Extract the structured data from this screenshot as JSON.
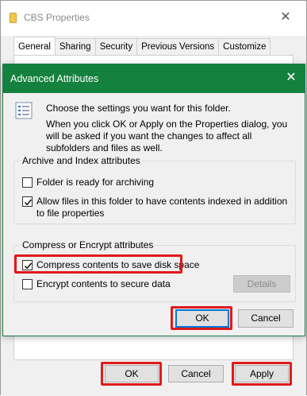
{
  "properties_window": {
    "title": "CBS Properties",
    "tabs": [
      "General",
      "Sharing",
      "Security",
      "Previous Versions",
      "Customize"
    ],
    "active_tab": "General",
    "buttons": {
      "ok": "OK",
      "cancel": "Cancel",
      "apply": "Apply"
    }
  },
  "advanced_dialog": {
    "title": "Advanced Attributes",
    "intro_line": "Choose the settings you want for this folder.",
    "intro_paragraph": "When you click OK or Apply on the Properties dialog, you will be asked if you want the changes to affect all subfolders and files as well.",
    "archive_group": {
      "label": "Archive and Index attributes",
      "options": [
        {
          "label": "Folder is ready for archiving",
          "checked": false
        },
        {
          "label": "Allow files in this folder to have contents indexed in addition to file properties",
          "checked": true
        }
      ]
    },
    "compress_group": {
      "label": "Compress or Encrypt attributes",
      "options": [
        {
          "label": "Compress contents to save disk space",
          "checked": true
        },
        {
          "label": "Encrypt contents to secure data",
          "checked": false
        }
      ],
      "details_label": "Details"
    },
    "buttons": {
      "ok": "OK",
      "cancel": "Cancel"
    }
  },
  "colors": {
    "dialog_titlebar": "#15813f",
    "highlight": "#e0191b",
    "focus_border": "#0078d7"
  },
  "icons": [
    "folder-icon",
    "close-icon",
    "info-list-icon",
    "checkmark-icon"
  ]
}
